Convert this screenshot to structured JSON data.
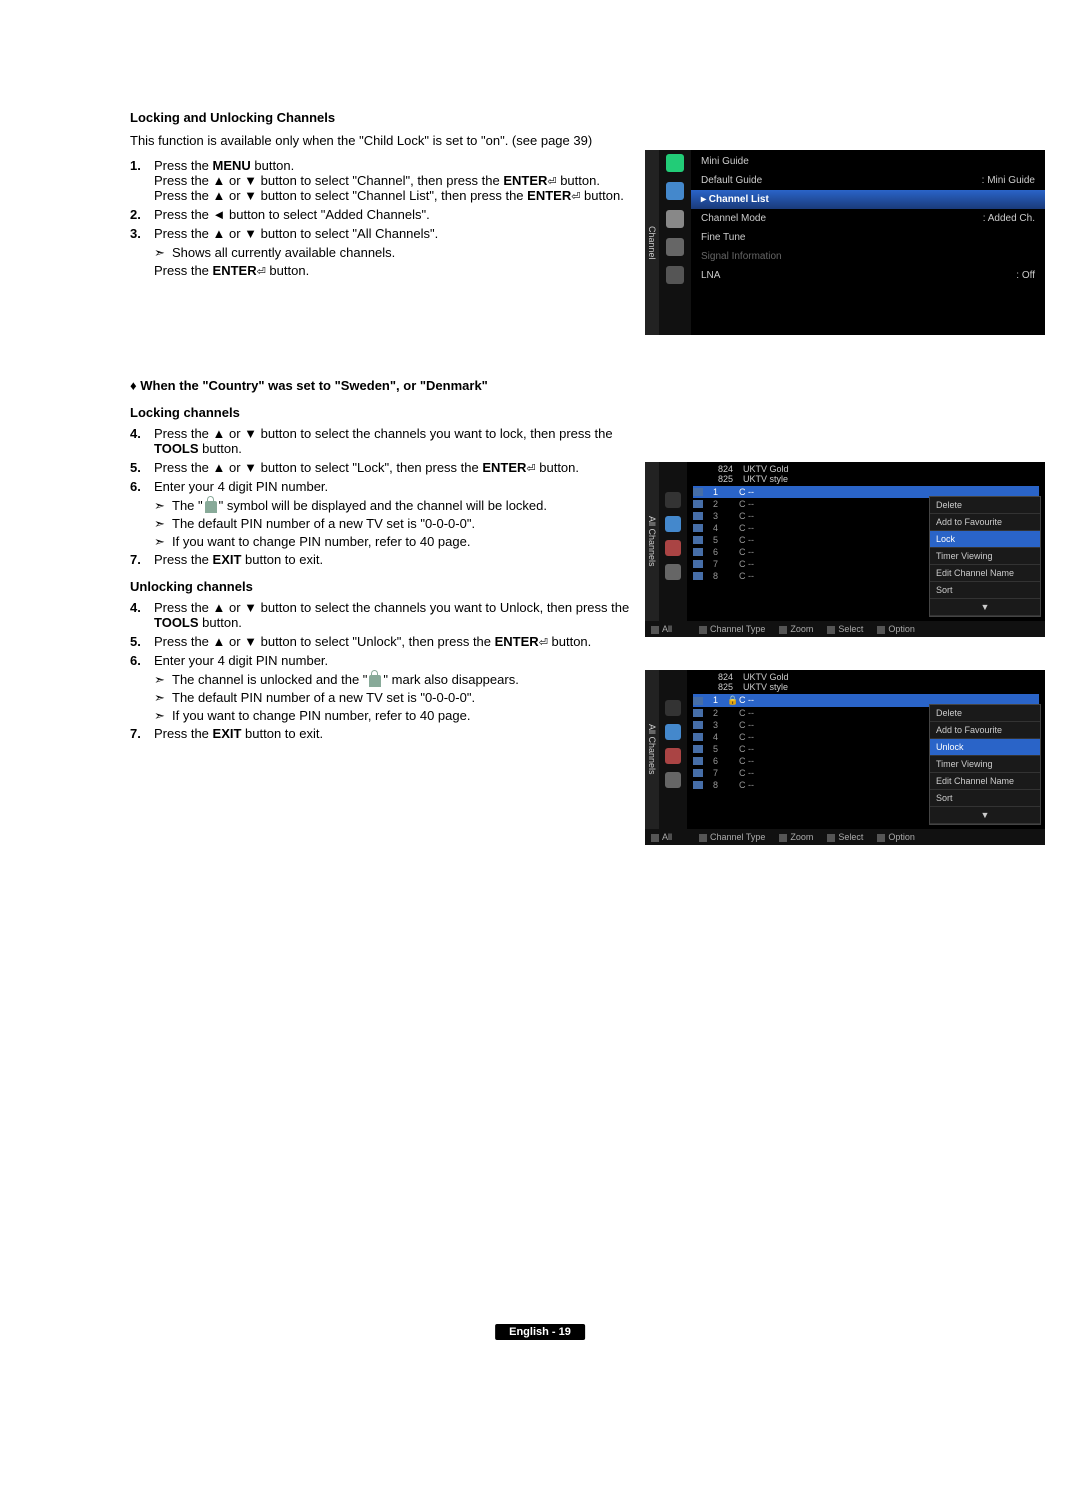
{
  "title": "Locking and Unlocking Channels",
  "intro": "This function is available only when the \"Child Lock\" is set to \"on\". (see page 39)",
  "steps_top": {
    "s1a_prefix": "Press the ",
    "s1a_bold": "MENU",
    "s1a_suffix": " button.",
    "s1b": "Press the ▲ or ▼ button to select \"Channel\", then press the ",
    "s1b_bold": "ENTER",
    "s1b_suffix": " button.",
    "s1c": "Press the ▲ or ▼ button to select \"Channel List\", then press the ",
    "s1c_bold": "ENTER",
    "s1c_suffix": " button.",
    "s2": "Press the ◄ button to select \"Added Channels\".",
    "s3": "Press the ▲ or ▼ button to select \"All Channels\".",
    "s3_sub": "Shows all currently available channels.",
    "s3_after_prefix": "Press the ",
    "s3_after_bold": "ENTER",
    "s3_after_suffix": " button."
  },
  "diamond": "♦   When the \"Country\" was set to \"Sweden\", or \"Denmark\"",
  "locking_heading": "Locking channels",
  "locking": {
    "s4a": "Press the ▲ or ▼ button to select the channels you want to lock, then press the ",
    "s4a_bold": "TOOLS",
    "s4a_suffix": " button.",
    "s5": "Press the ▲ or ▼ button to select \"Lock\", then press the ",
    "s5_bold": "ENTER",
    "s5_suffix": " button.",
    "s6": "Enter your 4 digit PIN number.",
    "s6_sub1a": "The \"",
    "s6_sub1b": "\" symbol will be displayed and the channel will be locked.",
    "s6_sub2": "The default PIN number of a new TV set is \"0-0-0-0\".",
    "s6_sub3": "If you want to change PIN number, refer to 40 page.",
    "s7_prefix": " Press the ",
    "s7_bold": "EXIT",
    "s7_suffix": " button to exit."
  },
  "unlocking_heading": "Unlocking channels",
  "unlocking": {
    "s4a": "Press the ▲ or ▼ button to select the channels you want to Unlock, then press the ",
    "s4a_bold": "TOOLS",
    "s4a_suffix": " button.",
    "s5": "Press the ▲ or ▼ button to select \"Unlock\", then press the ",
    "s5_bold": "ENTER",
    "s5_suffix": " button.",
    "s6": "Enter your 4 digit PIN number.",
    "s6_sub1a": "The channel is unlocked and the \"",
    "s6_sub1b": "\" mark also disappears.",
    "s6_sub2": "The default PIN number of a new TV set is \"0-0-0-0\".",
    "s6_sub3": "If you want to change PIN number, refer to 40 page.",
    "s7_prefix": "Press the ",
    "s7_bold": "EXIT",
    "s7_suffix": " button to exit."
  },
  "tvmenu": {
    "side": "Channel",
    "items": [
      {
        "lbl": "Mini Guide",
        "val": ""
      },
      {
        "lbl": "Default Guide",
        "val": ": Mini Guide"
      },
      {
        "lbl": "Channel List",
        "val": "",
        "sel": true
      },
      {
        "lbl": "Channel Mode",
        "val": ": Added Ch."
      },
      {
        "lbl": "Fine Tune",
        "val": ""
      },
      {
        "lbl": "Signal Information",
        "val": "",
        "dim": true
      },
      {
        "lbl": "LNA",
        "val": ": Off"
      }
    ]
  },
  "chlist_side": "All Channels",
  "chlist_top": [
    {
      "n": "824",
      "name": "UKTV Gold"
    },
    {
      "n": "825",
      "name": "UKTV style"
    }
  ],
  "ch_rows": [
    "1",
    "2",
    "3",
    "4",
    "5",
    "6",
    "7",
    "8"
  ],
  "ch_sig": "C --",
  "popup_lock": [
    "Delete",
    "Add to Favourite",
    "Lock",
    "Timer Viewing",
    "Edit Channel Name",
    "Sort",
    "▼"
  ],
  "popup_lock_sel": 2,
  "popup_unlock": [
    "Delete",
    "Add to Favourite",
    "Unlock",
    "Timer Viewing",
    "Edit Channel Name",
    "Sort",
    "▼"
  ],
  "popup_unlock_sel": 2,
  "foot": {
    "all": "All",
    "ct": "Channel Type",
    "zoom": "Zoom",
    "sel": "Select",
    "opt": "Option"
  },
  "page_footer": "English - 19",
  "nums": {
    "n1": "1.",
    "n2": "2.",
    "n3": "3.",
    "n4": "4.",
    "n5": "5.",
    "n6": "6.",
    "n7": "7."
  },
  "arrow_glyph": "➣",
  "lock_glyph": "🔒"
}
